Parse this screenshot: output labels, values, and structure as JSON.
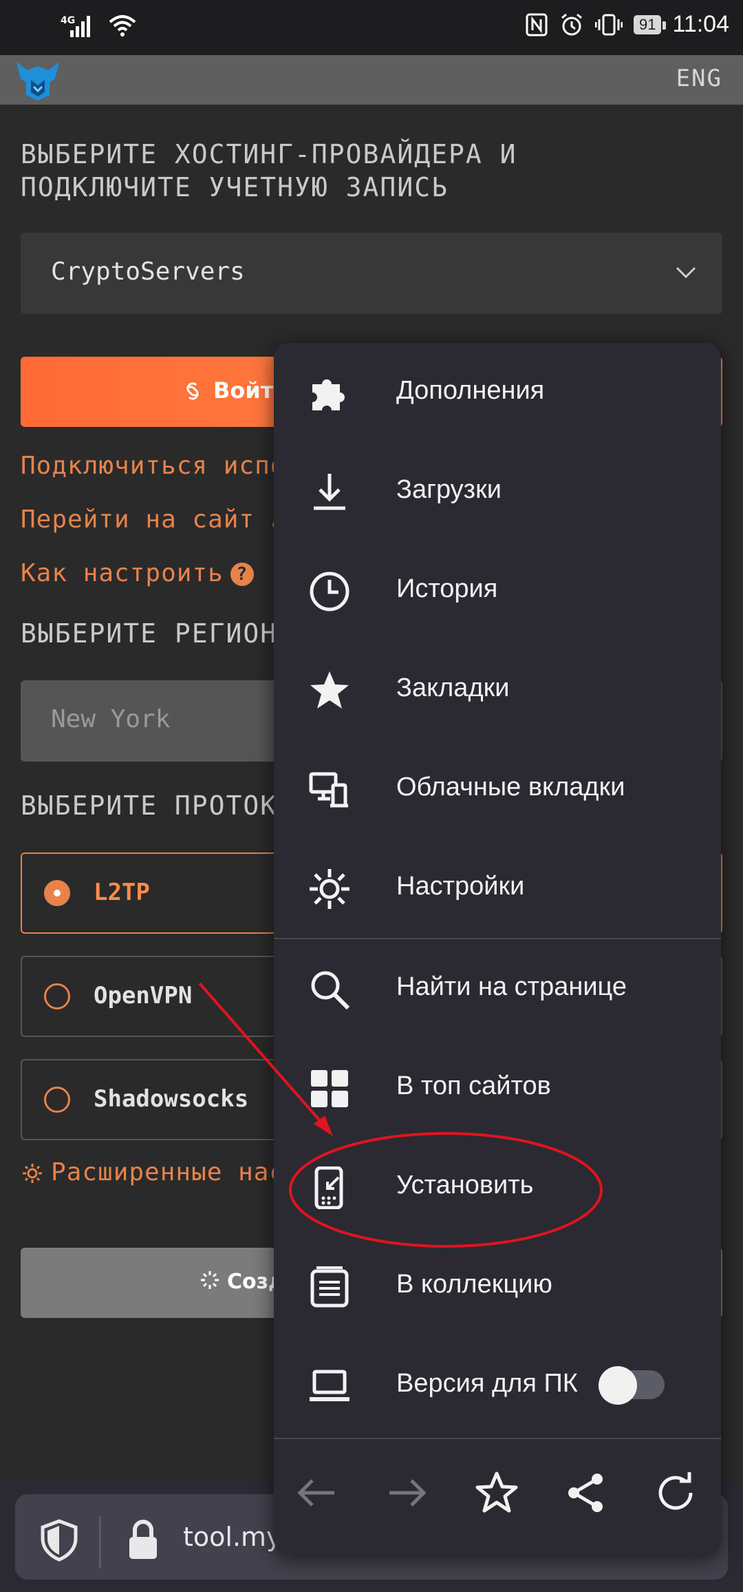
{
  "status_bar": {
    "network": "4G",
    "battery": "91",
    "time": "11:04"
  },
  "header": {
    "language": "ENG"
  },
  "page": {
    "hosting_title": "ВЫБЕРИТЕ ХОСТИНГ-ПРОВАЙДЕРА И ПОДКЛЮЧИТЕ УЧЕТНУЮ ЗАПИСЬ",
    "provider_value": "CryptoServers",
    "login_label": "Войти",
    "connect_link": "Подключиться испол",
    "site_link": "Перейти на сайт",
    "howto_link": "Как настроить",
    "region_title": "ВЫБЕРИТЕ РЕГИОН",
    "region_value": "New York",
    "protocol_title": "ВЫБЕРИТЕ ПРОТОКО",
    "protocols": [
      {
        "label": "L2TP",
        "selected": true
      },
      {
        "label": "OpenVPN",
        "selected": false
      },
      {
        "label": "Shadowsocks",
        "selected": false
      }
    ],
    "advanced_link": "Расширенные нас",
    "create_label": "Созда"
  },
  "browser": {
    "url": "tool.myv"
  },
  "menu": {
    "items": [
      {
        "label": "Дополнения",
        "icon": "puzzle-icon"
      },
      {
        "label": "Загрузки",
        "icon": "download-icon"
      },
      {
        "label": "История",
        "icon": "clock-icon"
      },
      {
        "label": "Закладки",
        "icon": "star-icon"
      },
      {
        "label": "Облачные вкладки",
        "icon": "synced-devices-icon"
      },
      {
        "label": "Настройки",
        "icon": "gear-icon"
      },
      {
        "label": "Найти на странице",
        "icon": "search-icon"
      },
      {
        "label": "В топ сайтов",
        "icon": "grid-icon"
      },
      {
        "label": "Установить",
        "icon": "install-app-icon"
      },
      {
        "label": "В коллекцию",
        "icon": "collection-icon"
      },
      {
        "label": "Версия для ПК",
        "icon": "laptop-icon"
      }
    ],
    "desktop_toggle_on": false
  },
  "colors": {
    "accent": "#e7834a",
    "menu_bg": "#2b2a33",
    "annotation": "#e0141e"
  }
}
